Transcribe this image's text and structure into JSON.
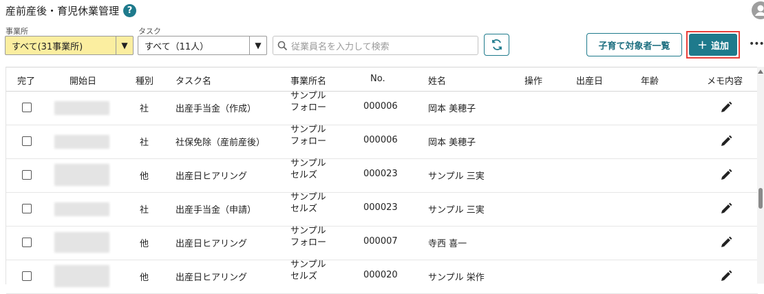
{
  "header": {
    "title": "産前産後・育児休業管理",
    "help_icon": "?"
  },
  "filters": {
    "office_label": "事業所",
    "office_value": "すべて(31事業所)",
    "task_label": "タスク",
    "task_value": "すべて（11人）",
    "search_placeholder": "従業員名を入力して検索"
  },
  "toolbar": {
    "list_button": "子育て対象者一覧",
    "add_button": "追加",
    "more": "•••"
  },
  "colors": {
    "accent": "#1e7a8c",
    "highlight": "#fbeea0",
    "alert": "#e8403a"
  },
  "table": {
    "columns": [
      "完了",
      "開始日",
      "種別",
      "タスク名",
      "事業所名",
      "No.",
      "姓名",
      "操作",
      "出産日",
      "年齢",
      "メモ内容"
    ],
    "rows": [
      {
        "type": "社",
        "task": "出産手当金（作成）",
        "office1": "サンプル",
        "office2": "フォロー",
        "no": "000006",
        "name": "岡本 美穂子"
      },
      {
        "type": "社",
        "task": "社保免除（産前産後）",
        "office1": "サンプル",
        "office2": "フォロー",
        "no": "000006",
        "name": "岡本 美穂子"
      },
      {
        "type": "他",
        "task": "出産日ヒアリング",
        "office1": "サンプル",
        "office2": "セルズ",
        "no": "000023",
        "name": "サンプル 三実"
      },
      {
        "type": "社",
        "task": "出産手当金（申請）",
        "office1": "サンプル",
        "office2": "セルズ",
        "no": "000023",
        "name": "サンプル 三実"
      },
      {
        "type": "他",
        "task": "出産日ヒアリング",
        "office1": "サンプル",
        "office2": "フォロー",
        "no": "000007",
        "name": "寺西 喜一"
      },
      {
        "type": "他",
        "task": "出産日ヒアリング",
        "office1": "サンプル",
        "office2": "セルズ",
        "no": "000020",
        "name": "サンプル 栄作"
      }
    ]
  }
}
